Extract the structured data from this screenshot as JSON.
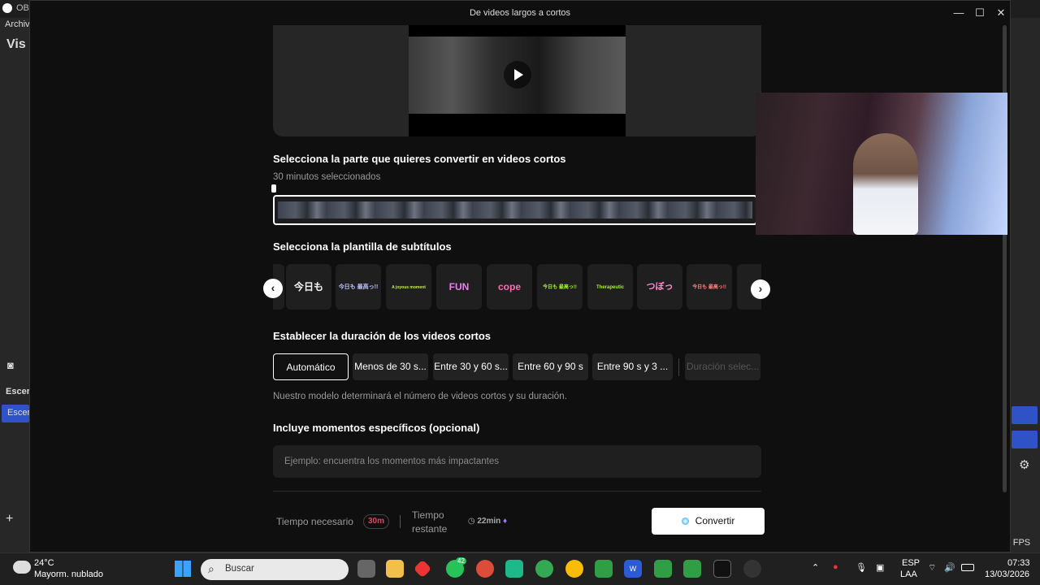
{
  "obs": {
    "app_short": "OB",
    "menu_archive": "Archiv",
    "view_short": "Vis",
    "scenes_short": "Escer",
    "scene_item_short": "Escer",
    "fps_short": ") FPS"
  },
  "dialog": {
    "title": "De videos largos a cortos"
  },
  "clip_section": {
    "heading": "Selecciona la parte que quieres convertir en videos cortos",
    "selected_text": "30 minutos seleccionados"
  },
  "subtitles_section": {
    "heading": "Selecciona la plantilla de subtítulos",
    "templates": [
      {
        "label": "今日も",
        "color": "#f4f4f4"
      },
      {
        "label": "今日も 最高っ!!",
        "color": "#b9c3ff"
      },
      {
        "label": "A joyous moment",
        "color": "#c7f046"
      },
      {
        "label": "FUN",
        "color": "#f07cf0"
      },
      {
        "label": "cope",
        "color": "#ff6ab4"
      },
      {
        "label": "今日も 最高っ!!",
        "color": "#a7f03c"
      },
      {
        "label": "Therapeutic",
        "color": "#a7f03c"
      },
      {
        "label": "つぼっ",
        "color": "#ff8ad0"
      },
      {
        "label": "今日も 最高っ!!",
        "color": "#ff8080"
      },
      {
        "label": "···",
        "color": "#ddd"
      }
    ]
  },
  "duration_section": {
    "heading": "Establecer la duración de los videos cortos",
    "options": [
      {
        "label": "Automático",
        "active": true
      },
      {
        "label": "Menos de 30 s...",
        "active": false
      },
      {
        "label": "Entre 30 y 60 s...",
        "active": false
      },
      {
        "label": "Entre 60 y 90 s",
        "active": false
      },
      {
        "label": "Entre 90 s y 3 ...",
        "active": false
      },
      {
        "label": "Duración selec...",
        "active": false
      }
    ],
    "hint": "Nuestro modelo determinará el número de videos cortos y su duración."
  },
  "moments_section": {
    "heading": "Incluye momentos específicos (opcional)",
    "placeholder": "Ejemplo: encuentra los momentos más impactantes"
  },
  "footer": {
    "time_needed_label": "Tiempo necesario",
    "time_needed_value": "30m",
    "time_remaining_label_1": "Tiempo",
    "time_remaining_label_2": "restante",
    "time_remaining_value": "22min",
    "convert_label": "Convertir"
  },
  "taskbar": {
    "weather_temp": "24°C",
    "weather_desc": "Mayorm. nublado",
    "search_label": "Buscar",
    "whatsapp_badge": "42",
    "lang_1": "ESP",
    "lang_2": "LAA",
    "time": "07:33",
    "date": "13/03/2026"
  }
}
